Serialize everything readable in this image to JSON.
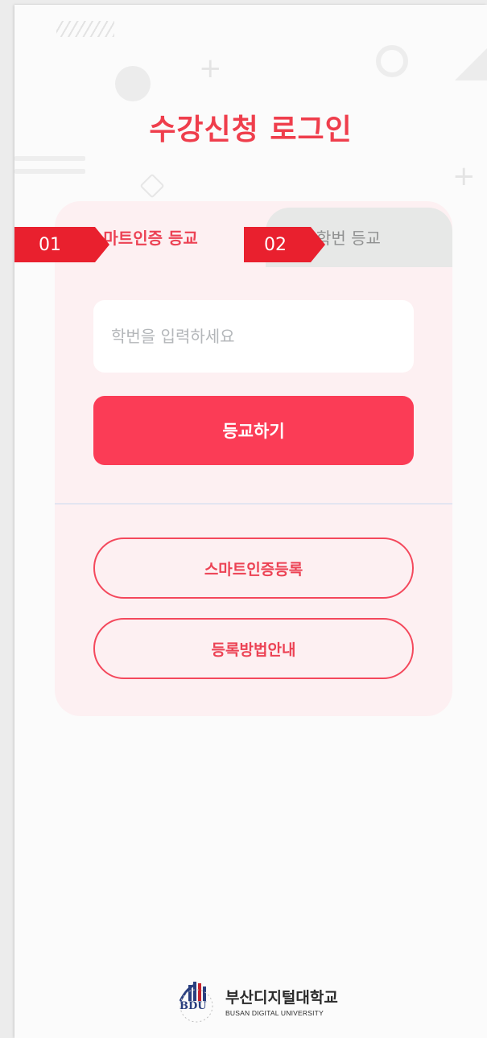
{
  "page": {
    "title": "수강신청 로그인"
  },
  "tabs": [
    {
      "label": "스마트인증 등교",
      "active": true
    },
    {
      "label": "학번 등교",
      "active": false
    }
  ],
  "form": {
    "student_id_placeholder": "학번을 입력하세요",
    "student_id_value": "",
    "submit_label": "등교하기"
  },
  "actions": {
    "register_label": "스마트인증등록",
    "guide_label": "등록방법안내"
  },
  "annotations": {
    "step1": "01",
    "step2": "02"
  },
  "footer": {
    "emblem_text": "BDU",
    "school_name_ko": "부산디지털대학교",
    "school_name_en": "BUSAN DIGITAL UNIVERSITY"
  },
  "colors": {
    "accent": "#fb3c56",
    "title": "#ef3e4c",
    "card_bg": "#fdf0f2",
    "annotation": "#e9202e"
  }
}
